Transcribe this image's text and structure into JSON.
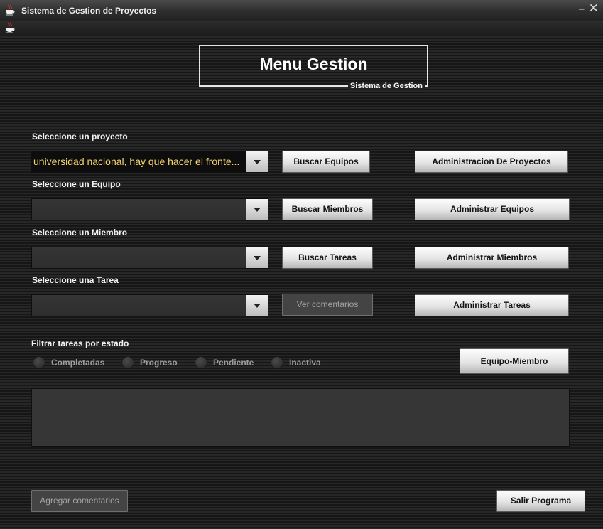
{
  "window": {
    "title": "Sistema de Gestion de Proyectos",
    "minimize_glyph": "–",
    "close_glyph": "✕"
  },
  "header": {
    "title": "Menu Gestion",
    "subtitle": "Sistema de Gestion"
  },
  "selectors": {
    "proyecto": {
      "label": "Seleccione un proyecto",
      "value": "universidad nacional, hay que hacer el fronte..."
    },
    "equipo": {
      "label": "Seleccione un Equipo",
      "value": ""
    },
    "miembro": {
      "label": "Seleccione un Miembro",
      "value": ""
    },
    "tarea": {
      "label": "Seleccione una Tarea",
      "value": ""
    }
  },
  "actions": {
    "buscar_equipos": "Buscar Equipos",
    "buscar_miembros": "Buscar Miembros",
    "buscar_tareas": "Buscar Tareas",
    "ver_comentarios": "Ver comentarios"
  },
  "admin": {
    "proyectos": "Administracion De Proyectos",
    "equipos": "Administrar Equipos",
    "miembros": "Administrar Miembros",
    "tareas": "Administrar Tareas",
    "equipo_miembro": "Equipo-Miembro"
  },
  "filter": {
    "label": "Filtrar tareas por estado",
    "options": [
      "Completadas",
      "Progreso",
      "Pendiente",
      "Inactiva"
    ]
  },
  "footer": {
    "agregar_comentarios": "Agregar comentarios",
    "salir": "Salir Programa"
  },
  "colors": {
    "selected_text": "#f7d46e",
    "background": "#1a1a1a"
  }
}
